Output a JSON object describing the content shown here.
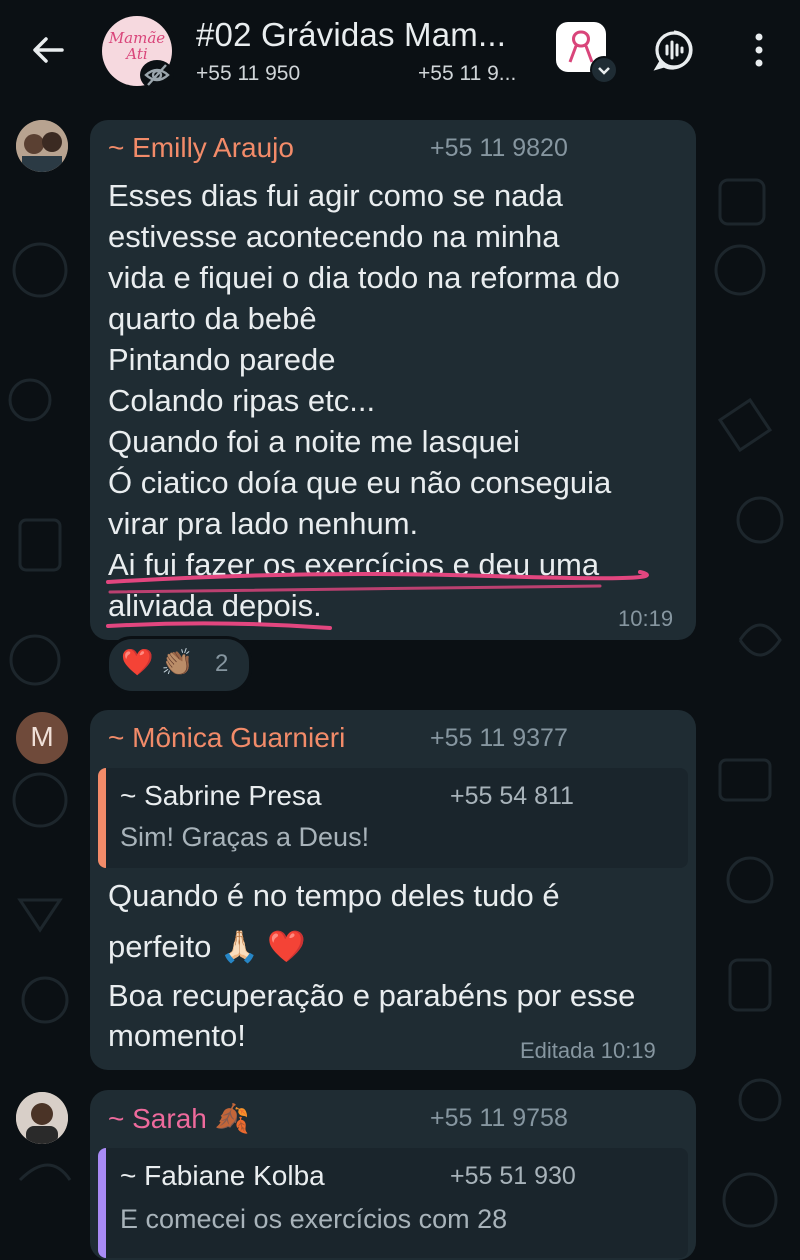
{
  "header": {
    "title": "#02 Grávidas Mam...",
    "participants_1": "+55 11 950",
    "participants_2": "+55 11 9...",
    "avatar_text_1": "Mamãe",
    "avatar_text_2": "Ati"
  },
  "messages": [
    {
      "sender": "~ Emilly Araujo",
      "sender_color": "#f28b69",
      "phone": "+55 11 9820",
      "lines": [
        "Esses dias fui agir como se nada",
        "estivesse acontecendo na minha",
        "vida e fiquei o dia todo na reforma do",
        "quarto da bebê",
        "Pintando parede",
        "Colando ripas etc...",
        "Quando foi a noite me lasquei",
        "Ó ciatico doía que eu não conseguia",
        "virar pra lado nenhum.",
        "Ai fui fazer os exercícios e deu uma",
        "aliviada depois."
      ],
      "time": "10:19",
      "reactions": {
        "emoji_1": "❤️",
        "emoji_2": "👏🏽",
        "count": "2"
      }
    },
    {
      "avatar_letter": "M",
      "sender": "~ Mônica Guarnieri",
      "sender_color": "#f28b69",
      "phone": "+55 11 9377",
      "quote": {
        "name": "~ Sabrine Presa",
        "phone": "+55 54 811",
        "text": "Sim! Graças a Deus!",
        "bar_color": "#f28b69"
      },
      "lines": [
        "Quando é no tempo deles tudo é",
        "perfeito 🙏🏻 ❤️",
        "Boa recuperação e parabéns por esse",
        "momento!"
      ],
      "time": "Editada 10:19"
    },
    {
      "sender": "~ Sarah 🍂",
      "sender_color": "#ee6a9c",
      "phone": "+55 11 9758",
      "quote": {
        "name": "~ Fabiane Kolba",
        "phone": "+55 51 930",
        "text": "E comecei os exercícios com 28",
        "bar_color": "#a98bf5"
      }
    }
  ]
}
